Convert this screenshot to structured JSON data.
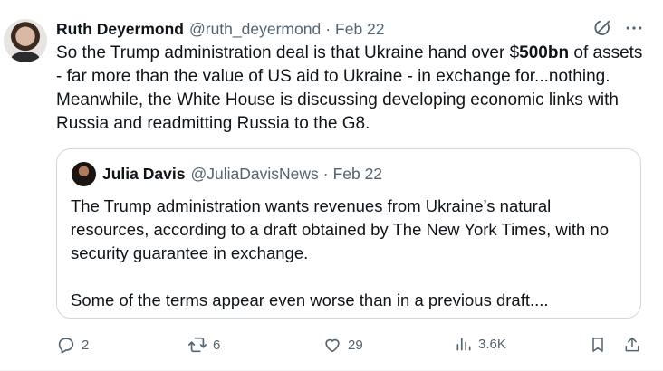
{
  "post": {
    "author_name": "Ruth Deyermond",
    "author_handle": "@ruth_deyermond",
    "separator": "·",
    "date": "Feb 22",
    "text_before_bold": "So the Trump administration deal is that Ukraine hand over $",
    "text_bold": "500bn",
    "text_after_bold": " of assets - far more than the value of US aid to Ukraine - in exchange for...nothing. Meanwhile, the White House is discussing developing economic links with Russia and readmitting Russia to the G8."
  },
  "quote": {
    "author_name": "Julia Davis",
    "author_handle": "@JuliaDavisNews",
    "separator": "·",
    "date": "Feb 22",
    "paragraph1": "The Trump administration wants revenues from Ukraine’s natural resources, according to a draft obtained by The New York Times, with no security guarantee in exchange.",
    "paragraph2": "Some of the terms appear even worse than in a previous draft...."
  },
  "actions": {
    "replies": "2",
    "reposts": "6",
    "likes": "29",
    "views": "3.6K"
  },
  "icons": {
    "grok": "grok-icon",
    "more": "more-icon",
    "reply": "reply-icon",
    "repost": "repost-icon",
    "like": "like-icon",
    "views": "views-icon",
    "bookmark": "bookmark-icon",
    "share": "share-icon"
  }
}
